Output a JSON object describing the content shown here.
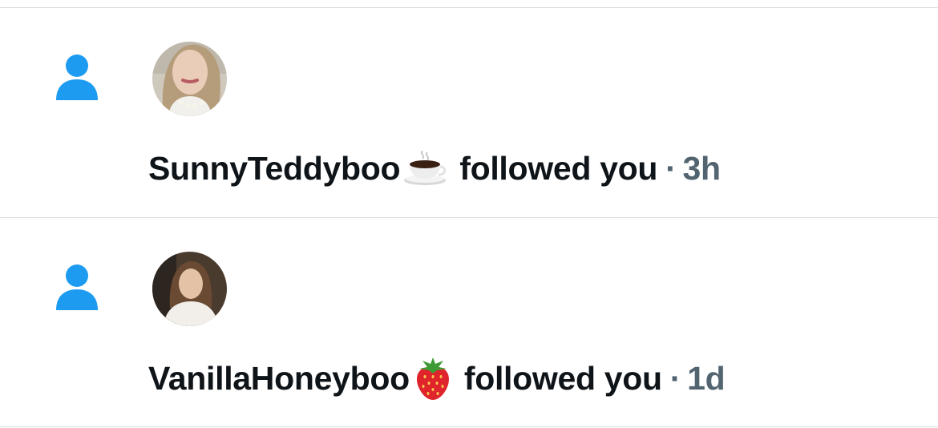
{
  "notifications": [
    {
      "icon": "person-icon",
      "avatar": "user-avatar",
      "username": "SunnyTeddyboo",
      "emoji": "coffee-cup-emoji",
      "action": "followed you",
      "separator": "·",
      "time": "3h"
    },
    {
      "icon": "person-icon",
      "avatar": "user-avatar",
      "username": "VanillaHoneyboo",
      "emoji": "strawberry-emoji",
      "action": "followed you",
      "separator": "·",
      "time": "1d"
    }
  ],
  "colors": {
    "icon_blue": "#1d9bf0",
    "text_primary": "#0f1419",
    "text_secondary": "#536471",
    "divider": "#d9dde0"
  }
}
